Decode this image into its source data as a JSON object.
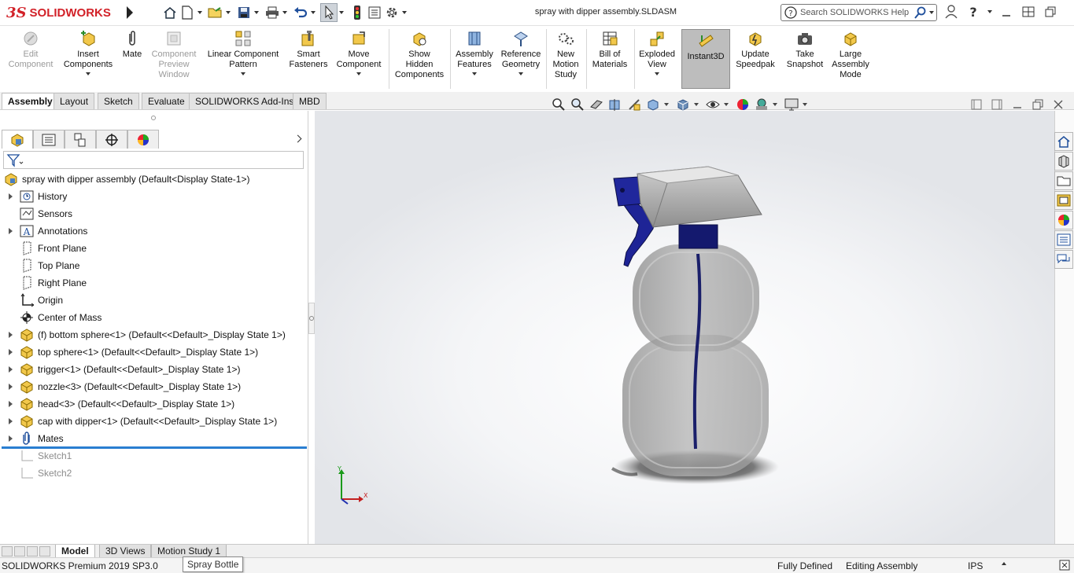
{
  "app": {
    "brand": "SOLIDWORKS",
    "document_title": "spray with dipper assembly.SLDASM"
  },
  "search": {
    "placeholder": "Search SOLIDWORKS Help"
  },
  "quick_access": [
    "home-icon",
    "new-document-icon",
    "open-folder-icon",
    "save-icon",
    "print-icon",
    "undo-icon",
    "select-arrow-icon",
    "traffic-light-icon",
    "file-properties-icon",
    "options-gear-icon"
  ],
  "window_controls": [
    "user-icon",
    "help-icon",
    "minimize-icon",
    "tile-icon",
    "restore-icon"
  ],
  "ribbon": {
    "edit_component": "Edit\nComponent",
    "insert_components": "Insert\nComponents",
    "mate": "Mate",
    "component_preview": "Component\nPreview\nWindow",
    "linear_pattern": "Linear Component\nPattern",
    "smart_fasteners": "Smart\nFasteners",
    "move_component": "Move\nComponent",
    "show_hidden": "Show\nHidden\nComponents",
    "assembly_features": "Assembly\nFeatures",
    "reference_geometry": "Reference\nGeometry",
    "new_motion_study": "New\nMotion\nStudy",
    "bill_of_materials": "Bill of\nMaterials",
    "exploded_view": "Exploded\nView",
    "instant3d": "Instant3D",
    "update_speedpak": "Update\nSpeedpak",
    "take_snapshot": "Take\nSnapshot",
    "large_assembly_mode": "Large\nAssembly\nMode"
  },
  "command_tabs": [
    "Assembly",
    "Layout",
    "Sketch",
    "Evaluate",
    "SOLIDWORKS Add-Ins",
    "MBD"
  ],
  "feature_tree": {
    "root": "spray with dipper assembly  (Default<Display State-1>)",
    "items": [
      "History",
      "Sensors",
      "Annotations",
      "Front Plane",
      "Top Plane",
      "Right Plane",
      "Origin",
      "Center of Mass",
      "(f) bottom sphere<1> (Default<<Default>_Display State 1>)",
      "top sphere<1> (Default<<Default>_Display State 1>)",
      "trigger<1> (Default<<Default>_Display State 1>)",
      "nozzle<3> (Default<<Default>_Display State 1>)",
      "head<3> (Default<<Default>_Display State 1>)",
      "cap with dipper<1> (Default<<Default>_Display State 1>)",
      "Mates",
      "Sketch1",
      "Sketch2"
    ]
  },
  "triad": {
    "x": "X",
    "y": "Y"
  },
  "bottom_tabs": [
    "Model",
    "3D Views",
    "Motion Study 1"
  ],
  "status": {
    "version": "SOLIDWORKS Premium 2019 SP3.0",
    "tooltip": "Spray Bottle",
    "state": "Fully Defined",
    "mode": "Editing Assembly",
    "units": "IPS"
  },
  "colors": {
    "brand_red": "#d22128",
    "accent_blue": "#2a7ed1",
    "trigger_navy": "#1a1f8a",
    "instant3d_active": "#bdbdbd"
  }
}
